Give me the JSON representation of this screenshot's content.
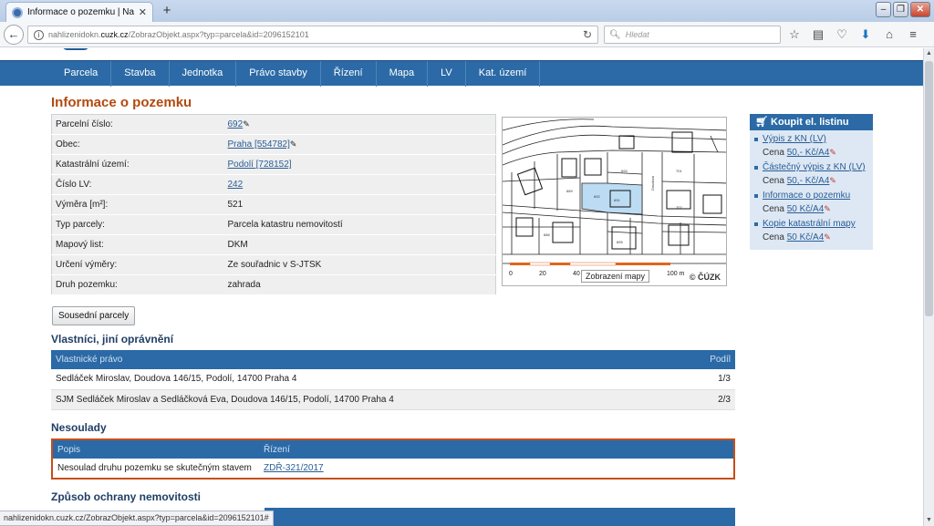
{
  "browser": {
    "tab_title": "Informace o pozemku | Nahlí",
    "url_prefix": "nahlizenidokn.",
    "url_host": "cuzk.cz",
    "url_path": "/ZobrazObjekt.aspx?typ=parcela&id=2096152101",
    "search_placeholder": "Hledat",
    "status_url": "nahlizenidokn.cuzk.cz/ZobrazObjekt.aspx?typ=parcela&id=2096152101#"
  },
  "nav": [
    "Parcela",
    "Stavba",
    "Jednotka",
    "Právo stavby",
    "Řízení",
    "Mapa",
    "LV",
    "Kat. území"
  ],
  "page_title": "Informace o pozemku",
  "info": [
    {
      "label": "Parcelní číslo:",
      "value": "692",
      "link": true,
      "pencil": true
    },
    {
      "label": "Obec:",
      "value": "Praha [554782]",
      "link": true,
      "pencil": true
    },
    {
      "label": "Katastrální území:",
      "value": "Podolí [728152]",
      "link": true,
      "pencil": false
    },
    {
      "label": "Číslo LV:",
      "value": "242",
      "link": true,
      "pencil": false
    },
    {
      "label": "Výměra [m²]:",
      "value": "521",
      "link": false,
      "pencil": false
    },
    {
      "label": "Typ parcely:",
      "value": "Parcela katastru nemovitostí",
      "link": false,
      "pencil": false
    },
    {
      "label": "Mapový list:",
      "value": "DKM",
      "link": false,
      "pencil": false
    },
    {
      "label": "Určení výměry:",
      "value": "Ze souřadnic v S-JTSK",
      "link": false,
      "pencil": false
    },
    {
      "label": "Druh pozemku:",
      "value": "zahrada",
      "link": false,
      "pencil": false
    }
  ],
  "map": {
    "tooltip": "Zobrazení mapy",
    "copyright": "© ČÚZK",
    "scale_0": "0",
    "scale_20": "20",
    "scale_40": "40",
    "scale_100": "100 m"
  },
  "sidebox": {
    "title": "Koupit el. listinu",
    "entries": [
      {
        "link": "Výpis z KN (LV)",
        "price_label": "Cena ",
        "price": "50,- Kč/A4"
      },
      {
        "link": "Částečný výpis z KN (LV)",
        "price_label": "Cena ",
        "price": "50,- Kč/A4"
      },
      {
        "link": "Informace o pozemku",
        "price_label": "Cena ",
        "price": "50 Kč/A4"
      },
      {
        "link": "Kopie katastrální mapy",
        "price_label": "Cena ",
        "price": "50 Kč/A4"
      }
    ]
  },
  "neighbors_button": "Sousední parcely",
  "owners": {
    "heading": "Vlastníci, jiní oprávnění",
    "col_right": "Vlastnické právo",
    "col_share": "Podíl",
    "rows": [
      {
        "name": "Sedláček Miroslav, Doudova 146/15, Podolí, 14700 Praha 4",
        "share": "1/3"
      },
      {
        "name": "SJM Sedláček Miroslav a Sedláčková Eva, Doudova 146/15, Podolí, 14700 Praha 4",
        "share": "2/3"
      }
    ]
  },
  "nesoulady": {
    "heading": "Nesoulady",
    "col_desc": "Popis",
    "col_proc": "Řízení",
    "rows": [
      {
        "desc": "Nesoulad druhu pozemku se skutečným stavem",
        "proc": "ZDŘ-321/2017"
      }
    ]
  },
  "protection_heading": "Způsob ochrany nemovitosti",
  "colors": {
    "nav_blue": "#2b6aa6",
    "title_orange": "#b34a0f",
    "highlight_parcel": "#bcdcf3",
    "scale_orange": "#e0661c"
  }
}
